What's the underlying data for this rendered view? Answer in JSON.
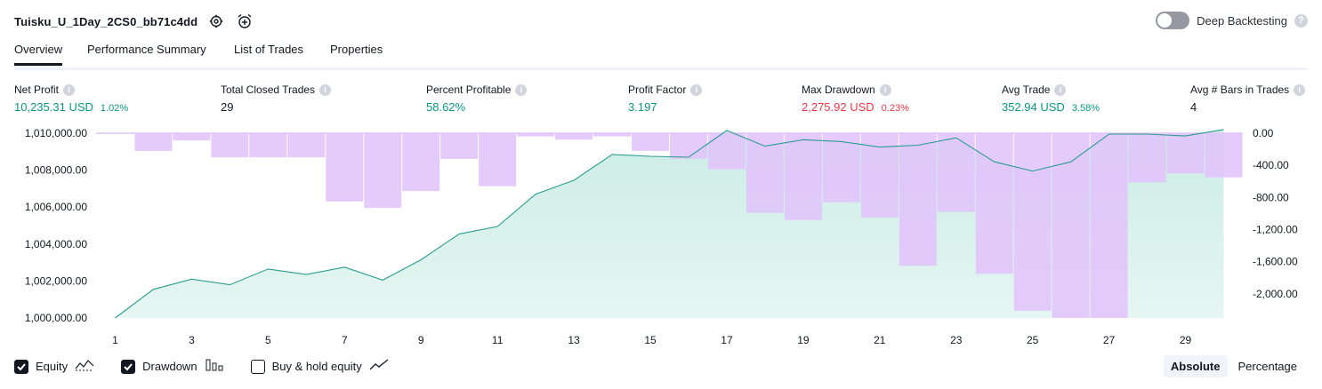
{
  "header": {
    "strategy_name": "Tuisku_U_1Day_2CS0_bb71c4dd",
    "settings_icon": "gear-icon",
    "add_alert_icon": "alarm-plus-icon"
  },
  "deep_backtesting": {
    "label": "Deep Backtesting",
    "enabled": false,
    "help": "?"
  },
  "tabs": [
    {
      "label": "Overview",
      "active": true
    },
    {
      "label": "Performance Summary",
      "active": false
    },
    {
      "label": "List of Trades",
      "active": false
    },
    {
      "label": "Properties",
      "active": false
    }
  ],
  "metrics": [
    {
      "label": "Net Profit",
      "value": "10,235.31 USD",
      "pct": "1.02%",
      "tone": "pos"
    },
    {
      "label": "Total Closed Trades",
      "value": "29",
      "pct": "",
      "tone": "plain"
    },
    {
      "label": "Percent Profitable",
      "value": "58.62%",
      "pct": "",
      "tone": "pos"
    },
    {
      "label": "Profit Factor",
      "value": "3.197",
      "pct": "",
      "tone": "pos"
    },
    {
      "label": "Max Drawdown",
      "value": "2,275.92 USD",
      "pct": "0.23%",
      "tone": "neg"
    },
    {
      "label": "Avg Trade",
      "value": "352.94 USD",
      "pct": "3.58%",
      "tone": "pos"
    },
    {
      "label": "Avg # Bars in Trades",
      "value": "4",
      "pct": "",
      "tone": "plain"
    }
  ],
  "colors": {
    "equity_line": "#2a9d8f",
    "equity_fill": "#c8ebe3",
    "drawdown_fill": "#e1c4fc",
    "positive": "#089981",
    "negative": "#f23645"
  },
  "chart_data": {
    "type": "area",
    "x_ticks": [
      "1",
      "3",
      "5",
      "7",
      "9",
      "11",
      "13",
      "15",
      "17",
      "19",
      "21",
      "23",
      "25",
      "27",
      "29"
    ],
    "x": [
      1,
      2,
      3,
      4,
      5,
      6,
      7,
      8,
      9,
      10,
      11,
      12,
      13,
      14,
      15,
      16,
      17,
      18,
      19,
      20,
      21,
      22,
      23,
      24,
      25,
      26,
      27,
      28,
      29,
      30
    ],
    "series": [
      {
        "values": [
          1000000,
          1001550,
          1002100,
          1001800,
          1002650,
          1002350,
          1002750,
          1002050,
          1003150,
          1004550,
          1004950,
          1006700,
          1007450,
          1008850,
          1008750,
          1008700,
          1010150,
          1009300,
          1009650,
          1009550,
          1009250,
          1009350,
          1009750,
          1008450,
          1007950,
          1008450,
          1009950,
          1009950,
          1009850,
          1010200
        ]
      },
      {
        "values": [
          0,
          -220,
          -90,
          -300,
          -300,
          -300,
          -850,
          -930,
          -720,
          -320,
          -660,
          -40,
          -80,
          -40,
          -220,
          -320,
          -450,
          -990,
          -1080,
          -860,
          -1050,
          -1650,
          -980,
          -1750,
          -2210,
          -2300,
          -2300,
          -610,
          -500,
          -550
        ]
      }
    ],
    "y_left": {
      "ticks": [
        "1,000,000.00",
        "1,002,000.00",
        "1,004,000.00",
        "1,006,000.00",
        "1,008,000.00",
        "1,010,000.00"
      ],
      "range": [
        1000000,
        1010000
      ]
    },
    "y_right": {
      "ticks": [
        "0.00",
        "-400.00",
        "-800.00",
        "-1,200.00",
        "-1,600.00",
        "-2,000.00"
      ],
      "range": [
        -2300,
        0
      ]
    }
  },
  "legend": [
    {
      "label": "Equity",
      "checked": true,
      "icon": "equity-line-icon"
    },
    {
      "label": "Drawdown",
      "checked": true,
      "icon": "drawdown-bars-icon"
    },
    {
      "label": "Buy & hold equity",
      "checked": false,
      "icon": "buy-hold-line-icon"
    }
  ],
  "modes": [
    {
      "label": "Absolute",
      "active": true
    },
    {
      "label": "Percentage",
      "active": false
    }
  ]
}
